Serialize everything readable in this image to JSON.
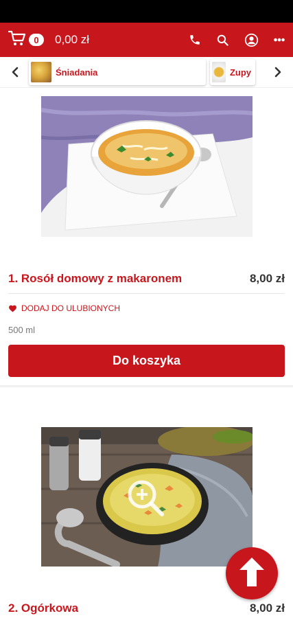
{
  "header": {
    "cart_count": "0",
    "cart_total": "0,00 zł",
    "icons": [
      "cart-icon",
      "phone-icon",
      "search-icon",
      "user-icon",
      "more-icon"
    ],
    "brand_color": "#c8161d"
  },
  "categories": {
    "items": [
      {
        "label": "Śniadania"
      },
      {
        "label": "Zupy"
      }
    ]
  },
  "products": [
    {
      "name": "1. Rosół domowy z makaronem",
      "price": "8,00 zł",
      "favorite_label": "DODAJ DO ULUBIONYCH",
      "description": "500 ml",
      "add_label": "Do koszyka"
    },
    {
      "name": "2. Ogórkowa",
      "price": "8,00 zł"
    }
  ]
}
